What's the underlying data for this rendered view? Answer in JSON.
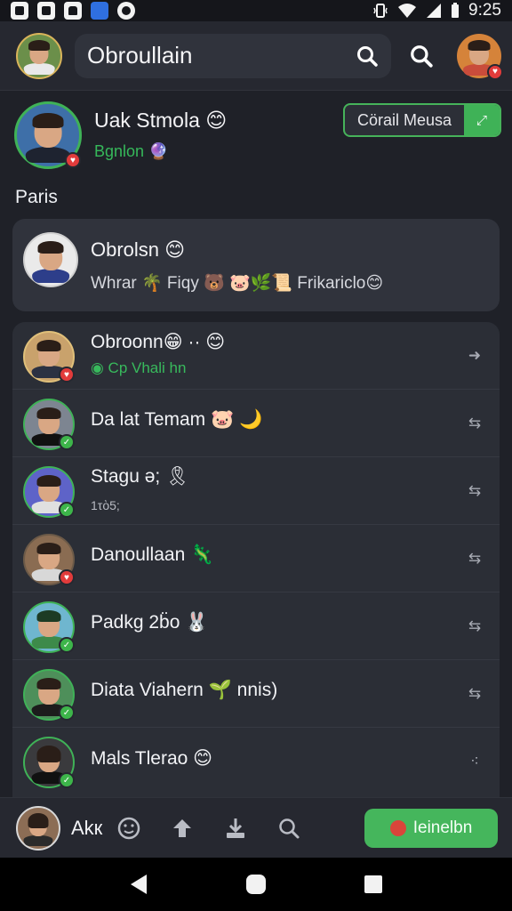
{
  "status_bar": {
    "time": "9:25"
  },
  "app_bar": {
    "title": "Obroullain"
  },
  "profile": {
    "name": "Uak Stmola",
    "emoji": "😊",
    "subtitle": "Bgnlon",
    "subtitle_emoji": "🔮",
    "button_label": "Cörail Meusa"
  },
  "section_label": "Paris",
  "featured": {
    "title": "Obrolsn",
    "title_emoji": "😊",
    "message": "Whrar 🌴 Fiqy 🐻 🐷🌿📜 Frikariclo😊"
  },
  "chats": [
    {
      "name": "Obroonn😁   ··   😊",
      "sub": "◉ Cp Vhali hn",
      "sub_style": "green",
      "badge": "red",
      "color": "#c9a26c"
    },
    {
      "name": "Da lat Temam 🐷 🌙",
      "sub": "",
      "badge": "green",
      "color": "#7d8591"
    },
    {
      "name": "Stagu ə; 🎗",
      "sub": "1τὸ5;",
      "sub_style": "grey",
      "badge": "green",
      "color": "#5e63c8"
    },
    {
      "name": "Danoullaan 🦎",
      "sub": "",
      "badge": "red",
      "color": "#8a6c52"
    },
    {
      "name": "Padkg 2b̈o 🐰",
      "sub": "",
      "badge": "green",
      "color": "#6fb6cf"
    },
    {
      "name": "Diata Viahern 🌱 nnis)",
      "sub": "",
      "badge": "green",
      "color": "#4e8f5a"
    },
    {
      "name": "Mals Tlerao 😊",
      "sub": "",
      "badge": "green",
      "color": "#3a3a3d"
    }
  ],
  "bottom_bar": {
    "user": "Akк",
    "cta_label": "Ieinelbn"
  }
}
